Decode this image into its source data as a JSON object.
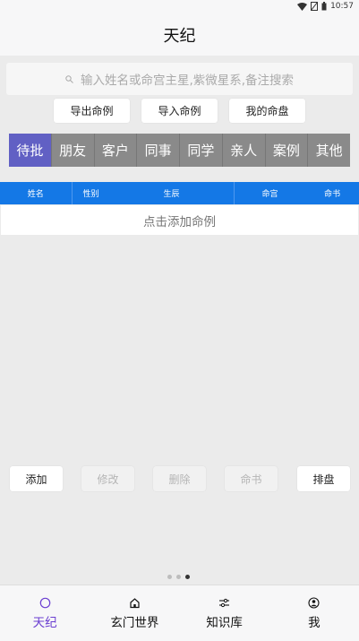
{
  "status": {
    "time": "10:57",
    "icons": [
      "wifi-icon",
      "no-sim-icon",
      "battery-icon"
    ]
  },
  "app": {
    "title": "天纪"
  },
  "search": {
    "placeholder": "输入姓名或命宫主星,紫微星系,备注搜索"
  },
  "actions": {
    "export": "导出命例",
    "import": "导入命例",
    "my_chart": "我的命盘"
  },
  "tabs": [
    {
      "label": "待批",
      "active": true
    },
    {
      "label": "朋友"
    },
    {
      "label": "客户"
    },
    {
      "label": "同事"
    },
    {
      "label": "同学"
    },
    {
      "label": "亲人"
    },
    {
      "label": "案例"
    },
    {
      "label": "其他"
    }
  ],
  "table": {
    "headers": [
      "姓名",
      "性别",
      "生辰",
      "命宫",
      "命书"
    ],
    "empty_text": "点击添加命例"
  },
  "bottom_actions": {
    "add": "添加",
    "edit": "修改",
    "delete": "删除",
    "book": "命书",
    "arrange": "排盘"
  },
  "pager": {
    "pages": 3,
    "current": 3
  },
  "nav": [
    {
      "label": "天纪",
      "icon": "circle-icon",
      "active": true
    },
    {
      "label": "玄门世界",
      "icon": "home-icon"
    },
    {
      "label": "知识库",
      "icon": "sliders-icon"
    },
    {
      "label": "我",
      "icon": "user-icon"
    }
  ],
  "colors": {
    "tab_active": "#6160c4",
    "tab": "#8a8a8a",
    "table_header": "#1478e6",
    "nav_active": "#6b3fd1"
  }
}
